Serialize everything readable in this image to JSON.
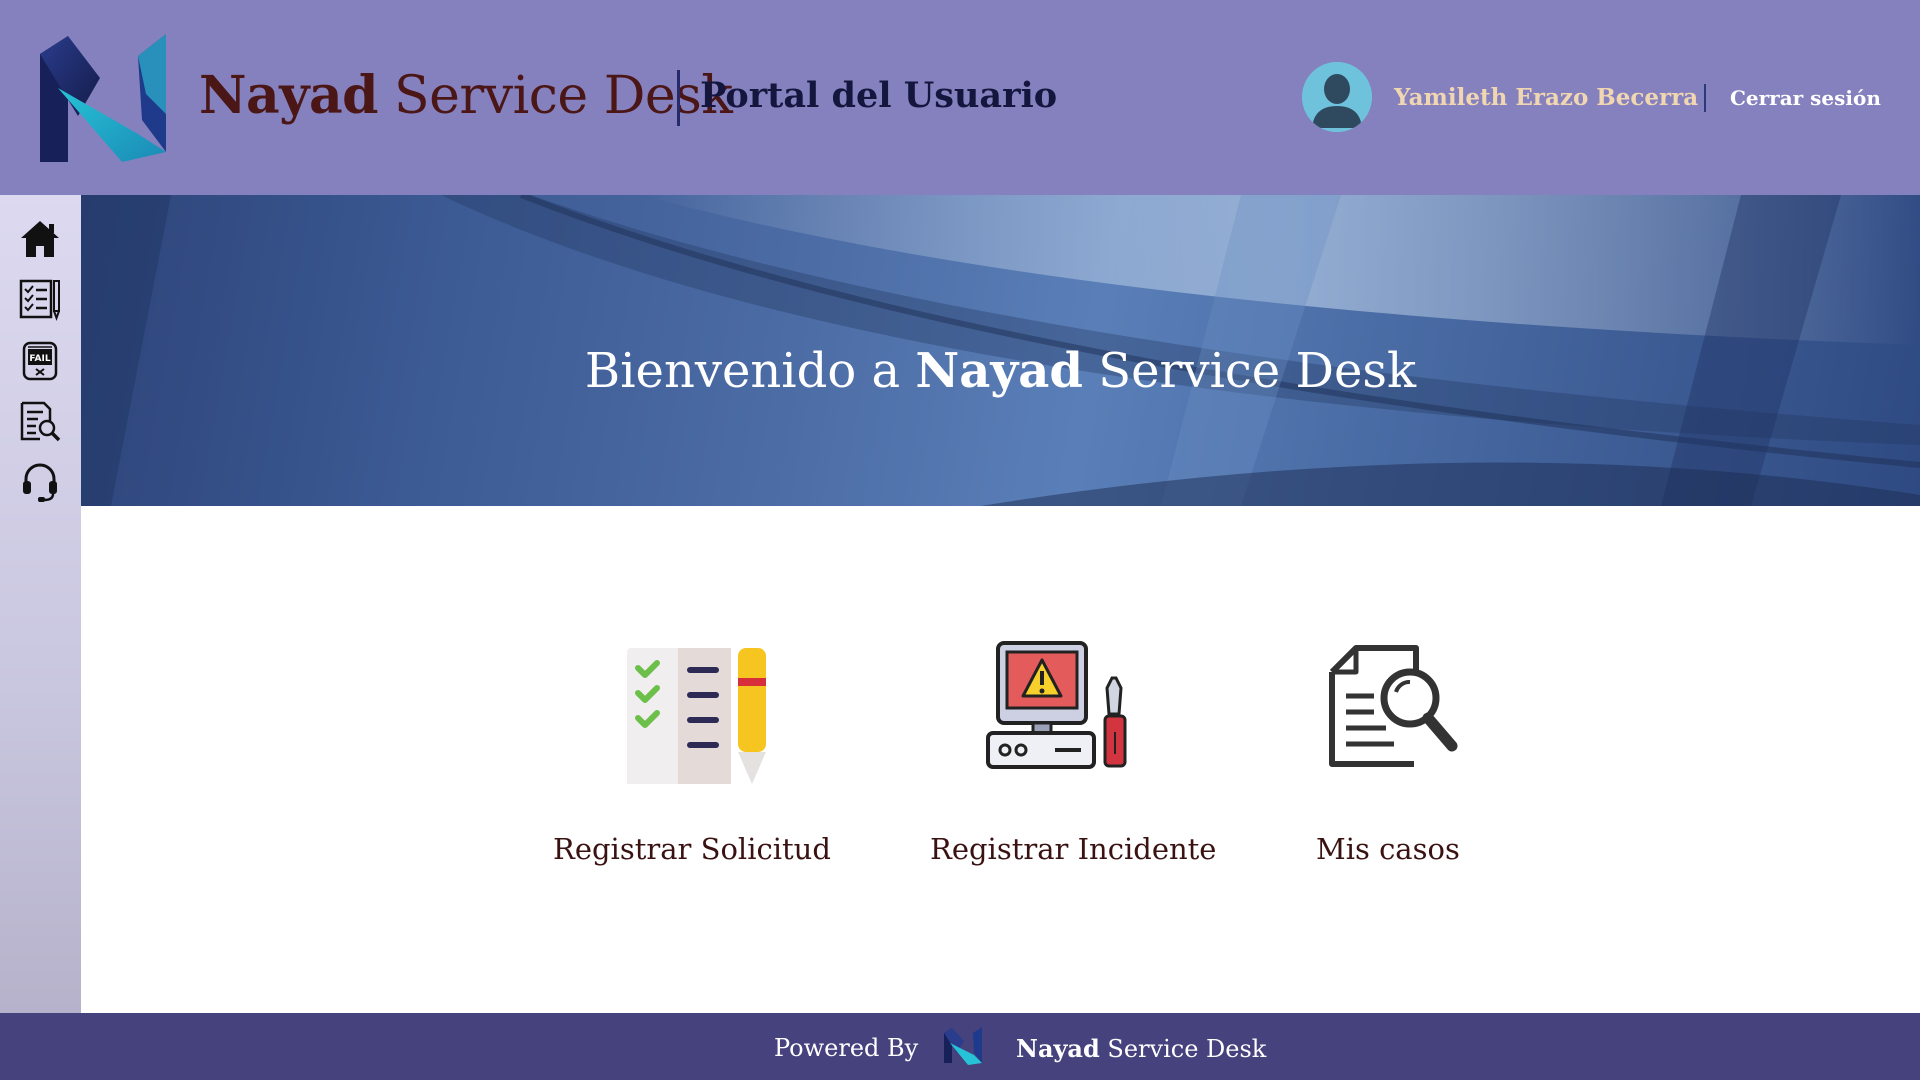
{
  "header": {
    "brand_bold": "Nayad",
    "brand_rest": " Service Desk",
    "portal_title": "Portal del Usuario",
    "user_name": "Yamileth Erazo Becerra",
    "logout_label": "Cerrar sesión"
  },
  "sidebar": {
    "items": [
      {
        "icon": "home-icon"
      },
      {
        "icon": "checklist-icon"
      },
      {
        "icon": "fail-monitor-icon"
      },
      {
        "icon": "document-search-icon"
      },
      {
        "icon": "headset-icon"
      }
    ]
  },
  "banner": {
    "welcome_prefix": "Bienvenido a ",
    "welcome_bold": "Nayad",
    "welcome_rest": " Service Desk"
  },
  "cards": [
    {
      "label": "Registrar Solicitud",
      "icon": "checklist-pencil-icon"
    },
    {
      "label": "Registrar Incidente",
      "icon": "computer-repair-icon"
    },
    {
      "label": "Mis casos",
      "icon": "document-search-icon"
    }
  ],
  "footer": {
    "powered_label": "Powered By",
    "brand_bold": "Nayad",
    "brand_rest": " Service Desk"
  },
  "colors": {
    "header_bg": "#8581be",
    "footer_bg": "#46427e",
    "brand_text": "#4a1616",
    "user_name": "#f1d7b1"
  }
}
